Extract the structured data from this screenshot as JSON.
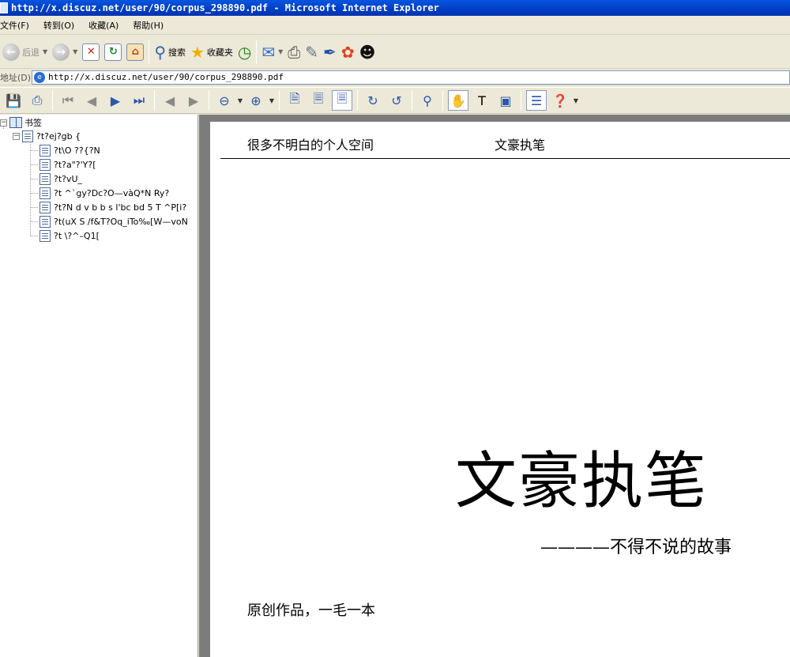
{
  "window": {
    "title": "http://x.discuz.net/user/90/corpus_298890.pdf - Microsoft Internet Explorer"
  },
  "menu": [
    {
      "label": "文件(F)"
    },
    {
      "label": "转到(O)"
    },
    {
      "label": "收藏(A)"
    },
    {
      "label": "帮助(H)"
    }
  ],
  "toolbar": {
    "back_label": "后退",
    "search_label": "搜索",
    "favorites_label": "收藏夹"
  },
  "address": {
    "label": "地址(D)",
    "url": "http://x.discuz.net/user/90/corpus_298890.pdf"
  },
  "bookmarks": {
    "root_label": "书签",
    "parent_label": "?t?ej?gb {",
    "items": [
      {
        "label": "?t\\O ??{?N"
      },
      {
        "label": "?t?a\"?'Y?["
      },
      {
        "label": "?t?vU_"
      },
      {
        "label": "?t ^`gy?Dc?O—vàQ*N Ry?"
      },
      {
        "label": "?t?N  d v b b s l'bc bd 5  T ^P[i?"
      },
      {
        "label": "?t(uX S /f&T?Oq_iTo‰[W—voN"
      },
      {
        "label": "?t \\?^–Q1["
      }
    ]
  },
  "document": {
    "header_left": "很多不明白的个人空间",
    "header_right": "文豪执笔",
    "title": "文豪执笔",
    "subtitle": "————不得不说的故事",
    "author": "原创作品，一毛一本"
  }
}
